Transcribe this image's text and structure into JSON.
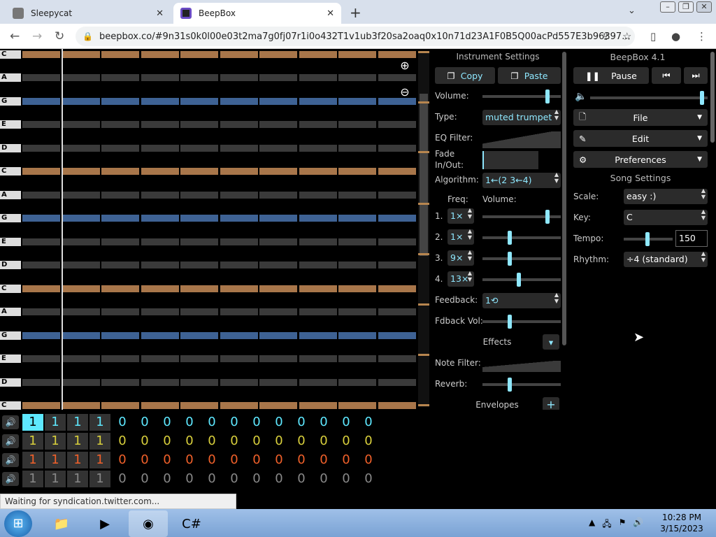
{
  "browser": {
    "tabs": [
      {
        "label": "Sleepycat",
        "close": "✕"
      },
      {
        "label": "BeepBox",
        "close": "✕"
      }
    ],
    "new_tab": "+",
    "url": "beepbox.co/#9n31s0k0l00e03t2ma7g0fj07r1i0o432T1v1ub3f20sa2oaq0x10n71d23A1F0B5Q00acPd557E3b96397...",
    "window_controls": [
      "–",
      "❐",
      "✕"
    ]
  },
  "piano_roll": {
    "key_labels": [
      {
        "note": "C",
        "color": "brown"
      },
      {
        "note": "A",
        "color": "gray"
      },
      {
        "note": "G",
        "color": "blue"
      },
      {
        "note": "E",
        "color": "gray"
      },
      {
        "note": "D",
        "color": "gray"
      },
      {
        "note": "C",
        "color": "brown"
      },
      {
        "note": "A",
        "color": "gray"
      },
      {
        "note": "G",
        "color": "blue"
      },
      {
        "note": "E",
        "color": "gray"
      },
      {
        "note": "D",
        "color": "gray"
      },
      {
        "note": "C",
        "color": "brown"
      },
      {
        "note": "A",
        "color": "gray"
      },
      {
        "note": "G",
        "color": "blue"
      },
      {
        "note": "E",
        "color": "gray"
      },
      {
        "note": "D",
        "color": "gray"
      },
      {
        "note": "C",
        "color": "brown"
      }
    ],
    "zoom_in": "⊕",
    "zoom_out": "⊖",
    "colors": {
      "brown": "#a8764a",
      "blue": "#3e6294",
      "gray": "#3a3a3a"
    }
  },
  "instrument": {
    "title": "Instrument Settings",
    "copy": "Copy",
    "paste": "Paste",
    "volume_label": "Volume:",
    "type_label": "Type:",
    "type_value": "muted trumpet",
    "eq_label": "EQ Filter:",
    "fade_label": "Fade In/Out:",
    "algorithm_label": "Algorithm:",
    "algorithm_value": "1←(2  3←4)",
    "freq_header": "Freq:",
    "vol_header": "Volume:",
    "operators": [
      {
        "n": "1.",
        "freq": "1×",
        "level": 0.85
      },
      {
        "n": "2.",
        "freq": "1×",
        "level": 0.34
      },
      {
        "n": "3.",
        "freq": "9×",
        "level": 0.34
      },
      {
        "n": "4.",
        "freq": "13×",
        "level": 0.46
      }
    ],
    "feedback_label": "Feedback:",
    "feedback_value": "1⟲",
    "fdback_vol_label": "Fdback Vol:",
    "fdback_vol_level": 0.34,
    "effects_label": "Effects",
    "effects_button": "▾",
    "note_filter_label": "Note Filter:",
    "reverb_label": "Reverb:",
    "reverb_level": 0.34,
    "envelopes_label": "Envelopes",
    "envelopes_button": "+",
    "volume_level": 0.85
  },
  "song": {
    "title": "BeepBox 4.1",
    "pause": "Pause",
    "prev_icon": "⏮",
    "next_icon": "⏭",
    "volume_level": 0.97,
    "file": "File",
    "edit": "Edit",
    "preferences": "Preferences",
    "settings_title": "Song Settings",
    "scale_label": "Scale:",
    "scale_value": "easy :)",
    "key_label": "Key:",
    "key_value": "C",
    "tempo_label": "Tempo:",
    "tempo_value": "150",
    "tempo_level": 0.48,
    "rhythm_label": "Rhythm:",
    "rhythm_value": "÷4 (standard)"
  },
  "pattern_editor": {
    "rows": [
      {
        "color": "#5ee8ff",
        "cells": [
          "1",
          "1",
          "1",
          "1",
          "0",
          "0",
          "0",
          "0",
          "0",
          "0",
          "0",
          "0",
          "0",
          "0",
          "0",
          "0"
        ]
      },
      {
        "color": "#d8cf3c",
        "cells": [
          "1",
          "1",
          "1",
          "1",
          "0",
          "0",
          "0",
          "0",
          "0",
          "0",
          "0",
          "0",
          "0",
          "0",
          "0",
          "0"
        ]
      },
      {
        "color": "#f0602a",
        "cells": [
          "1",
          "1",
          "1",
          "1",
          "0",
          "0",
          "0",
          "0",
          "0",
          "0",
          "0",
          "0",
          "0",
          "0",
          "0",
          "0"
        ]
      },
      {
        "color": "#888888",
        "cells": [
          "1",
          "1",
          "1",
          "1",
          "0",
          "0",
          "0",
          "0",
          "0",
          "0",
          "0",
          "0",
          "0",
          "0",
          "0",
          "0"
        ]
      }
    ]
  },
  "status_text": "Waiting for syndication.twitter.com...",
  "taskbar": {
    "clock_time": "10:28 PM",
    "clock_date": "3/15/2023",
    "apps": [
      "explorer-icon",
      "media-player-icon",
      "chrome-icon",
      "csharp-icon"
    ]
  }
}
